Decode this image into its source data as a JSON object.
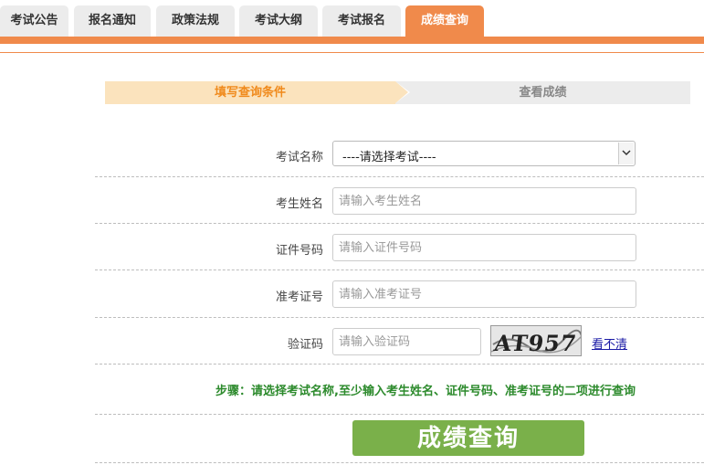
{
  "tabs": [
    {
      "label": "考试公告",
      "active": false
    },
    {
      "label": "报名通知",
      "active": false
    },
    {
      "label": "政策法规",
      "active": false
    },
    {
      "label": "考试大纲",
      "active": false
    },
    {
      "label": "考试报名",
      "active": false
    },
    {
      "label": "成绩查询",
      "active": true
    }
  ],
  "steps": {
    "step1": "填写查询条件",
    "step2": "查看成绩"
  },
  "form": {
    "exam_name_label": "考试名称",
    "exam_select_value": "----请选择考试----",
    "name_label": "考生姓名",
    "name_placeholder": "请输入考生姓名",
    "id_label": "证件号码",
    "id_placeholder": "请输入证件号码",
    "ticket_label": "准考证号",
    "ticket_placeholder": "请输入准考证号",
    "captcha_label": "验证码",
    "captcha_placeholder": "请输入验证码",
    "captcha_text": "AT957",
    "refresh_link": "看不清"
  },
  "hint": "步骤：请选择考试名称,至少输入考生姓名、证件号码、准考证号的二项进行查询",
  "submit_label": "成绩查询",
  "colors": {
    "accent": "#f08a4b",
    "step_active_bg": "#fbe3bd",
    "step_active_text": "#f08a1c",
    "hint_green": "#2c8a2c",
    "button_green": "#7ab04a"
  },
  "icons": {
    "select_arrow": "chevron-down-icon"
  }
}
